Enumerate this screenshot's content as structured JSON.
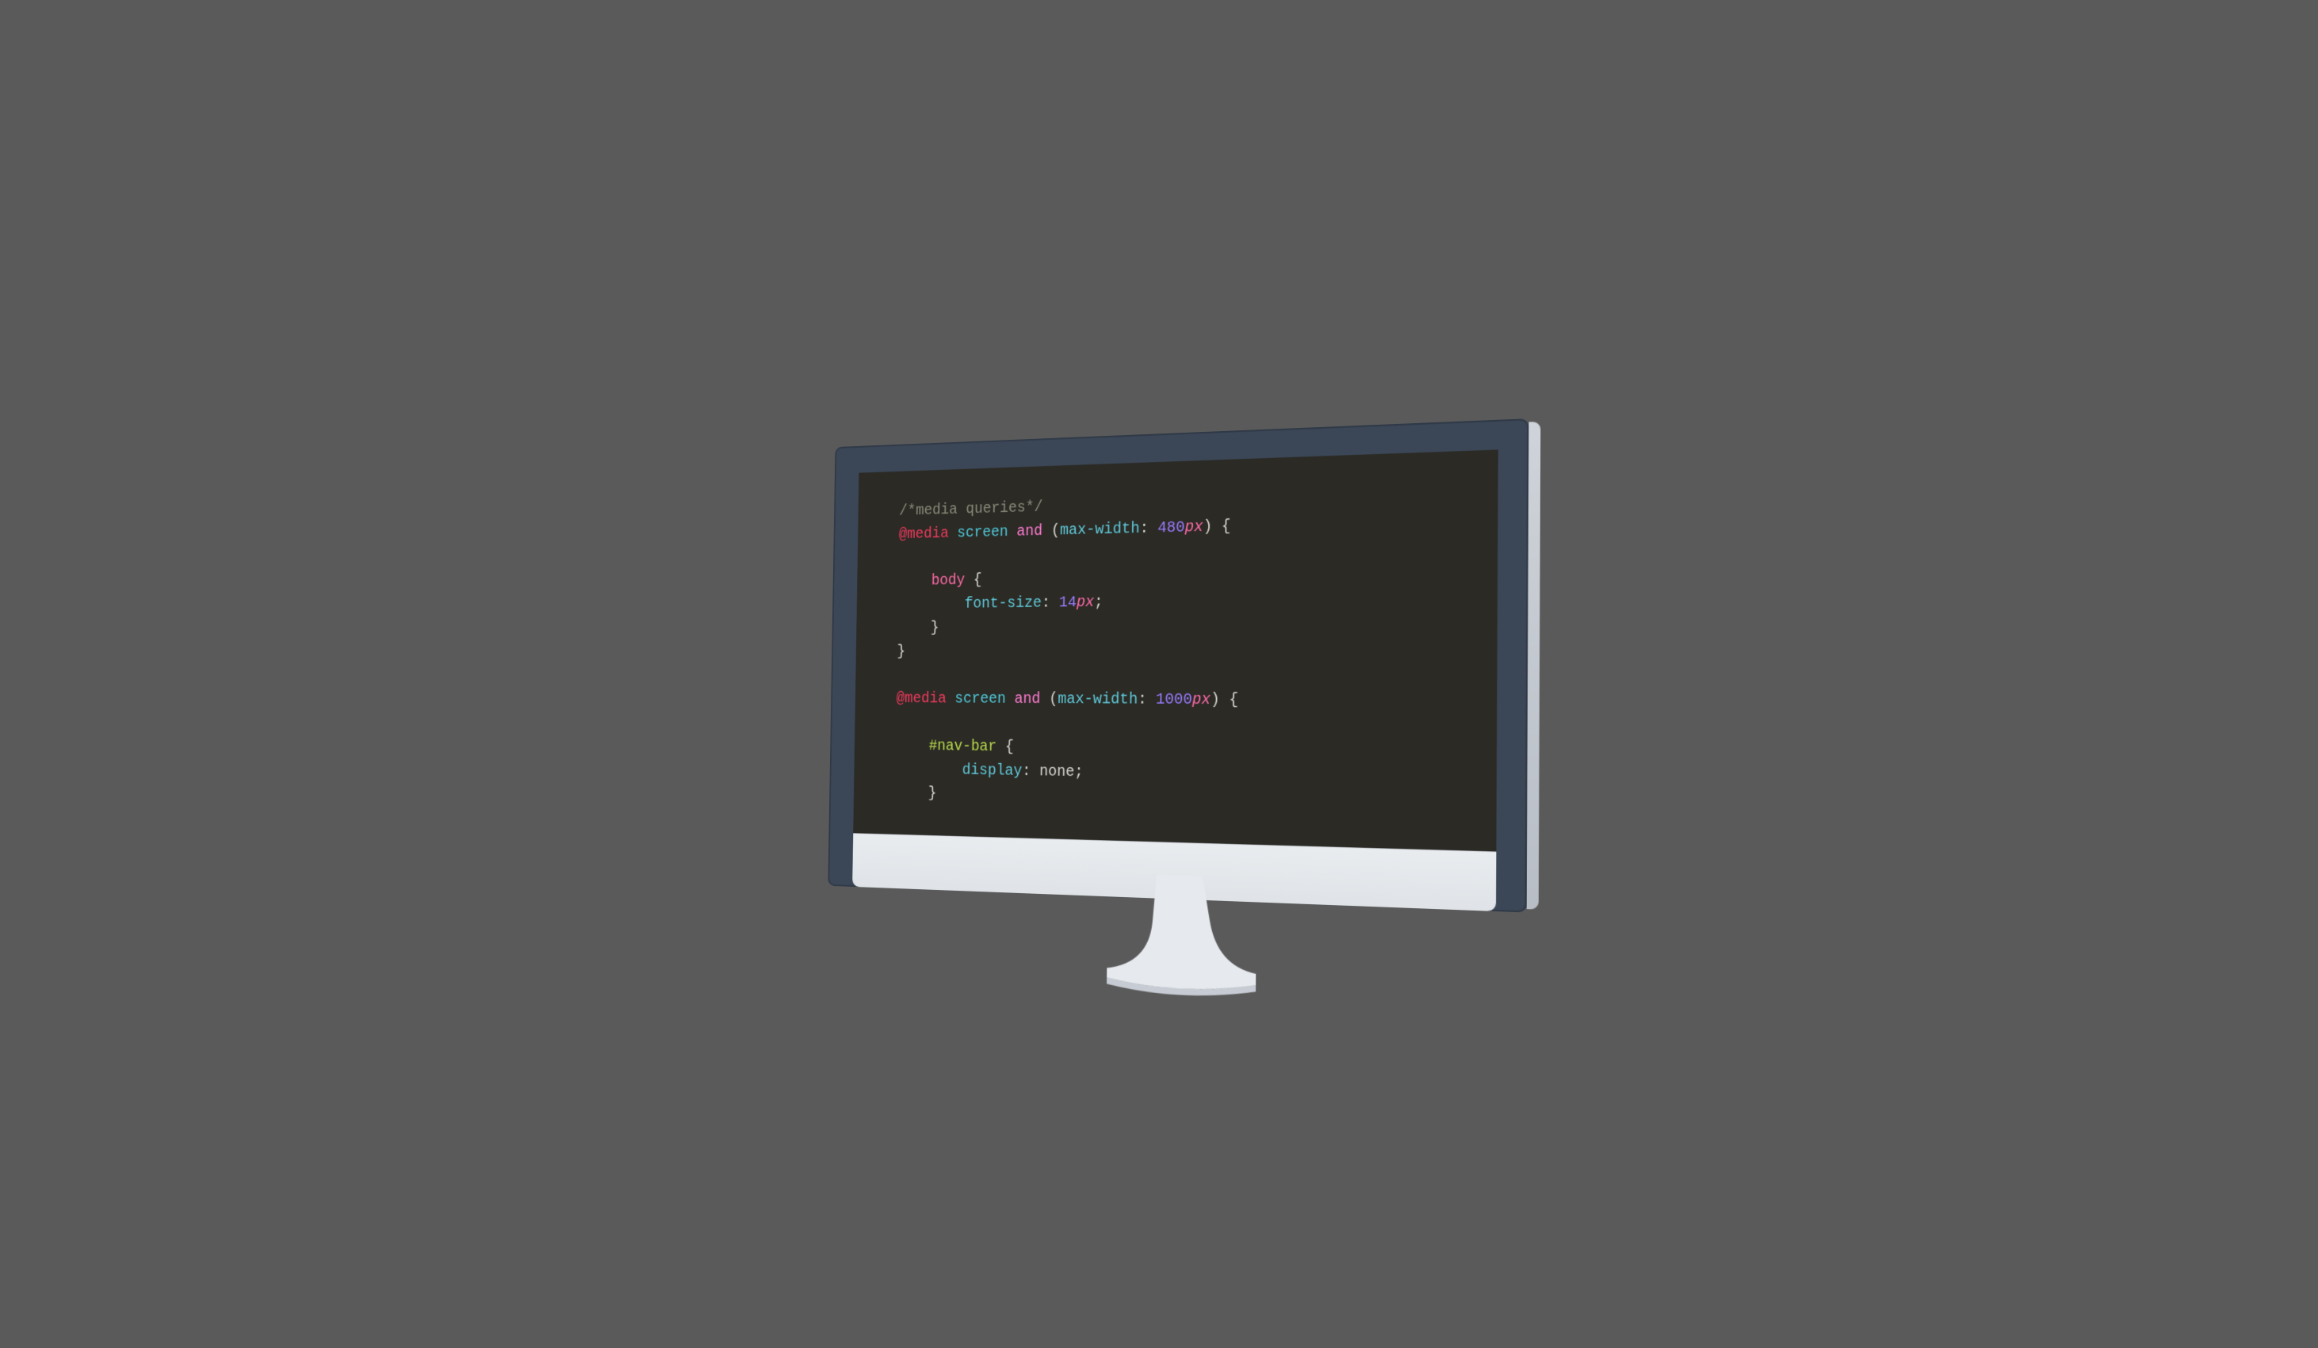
{
  "code": {
    "line1_comment": "/*media queries*/",
    "media_kw": "@media",
    "screen_kw": "screen",
    "and_kw": "and",
    "maxwidth_prop": "max-width",
    "q1_val": "480",
    "q1_unit": "px",
    "q2_val": "1000",
    "q2_unit": "px",
    "sel_body": "body",
    "prop_fontsize": "font-size",
    "val_fontsize_num": "14",
    "val_fontsize_unit": "px",
    "sel_navbar": "#nav-bar",
    "prop_display": "display",
    "val_none": "none",
    "brace_open": "{",
    "brace_close": "}",
    "paren_open": "(",
    "paren_close": ")",
    "colon": ":",
    "semicolon": ";"
  }
}
